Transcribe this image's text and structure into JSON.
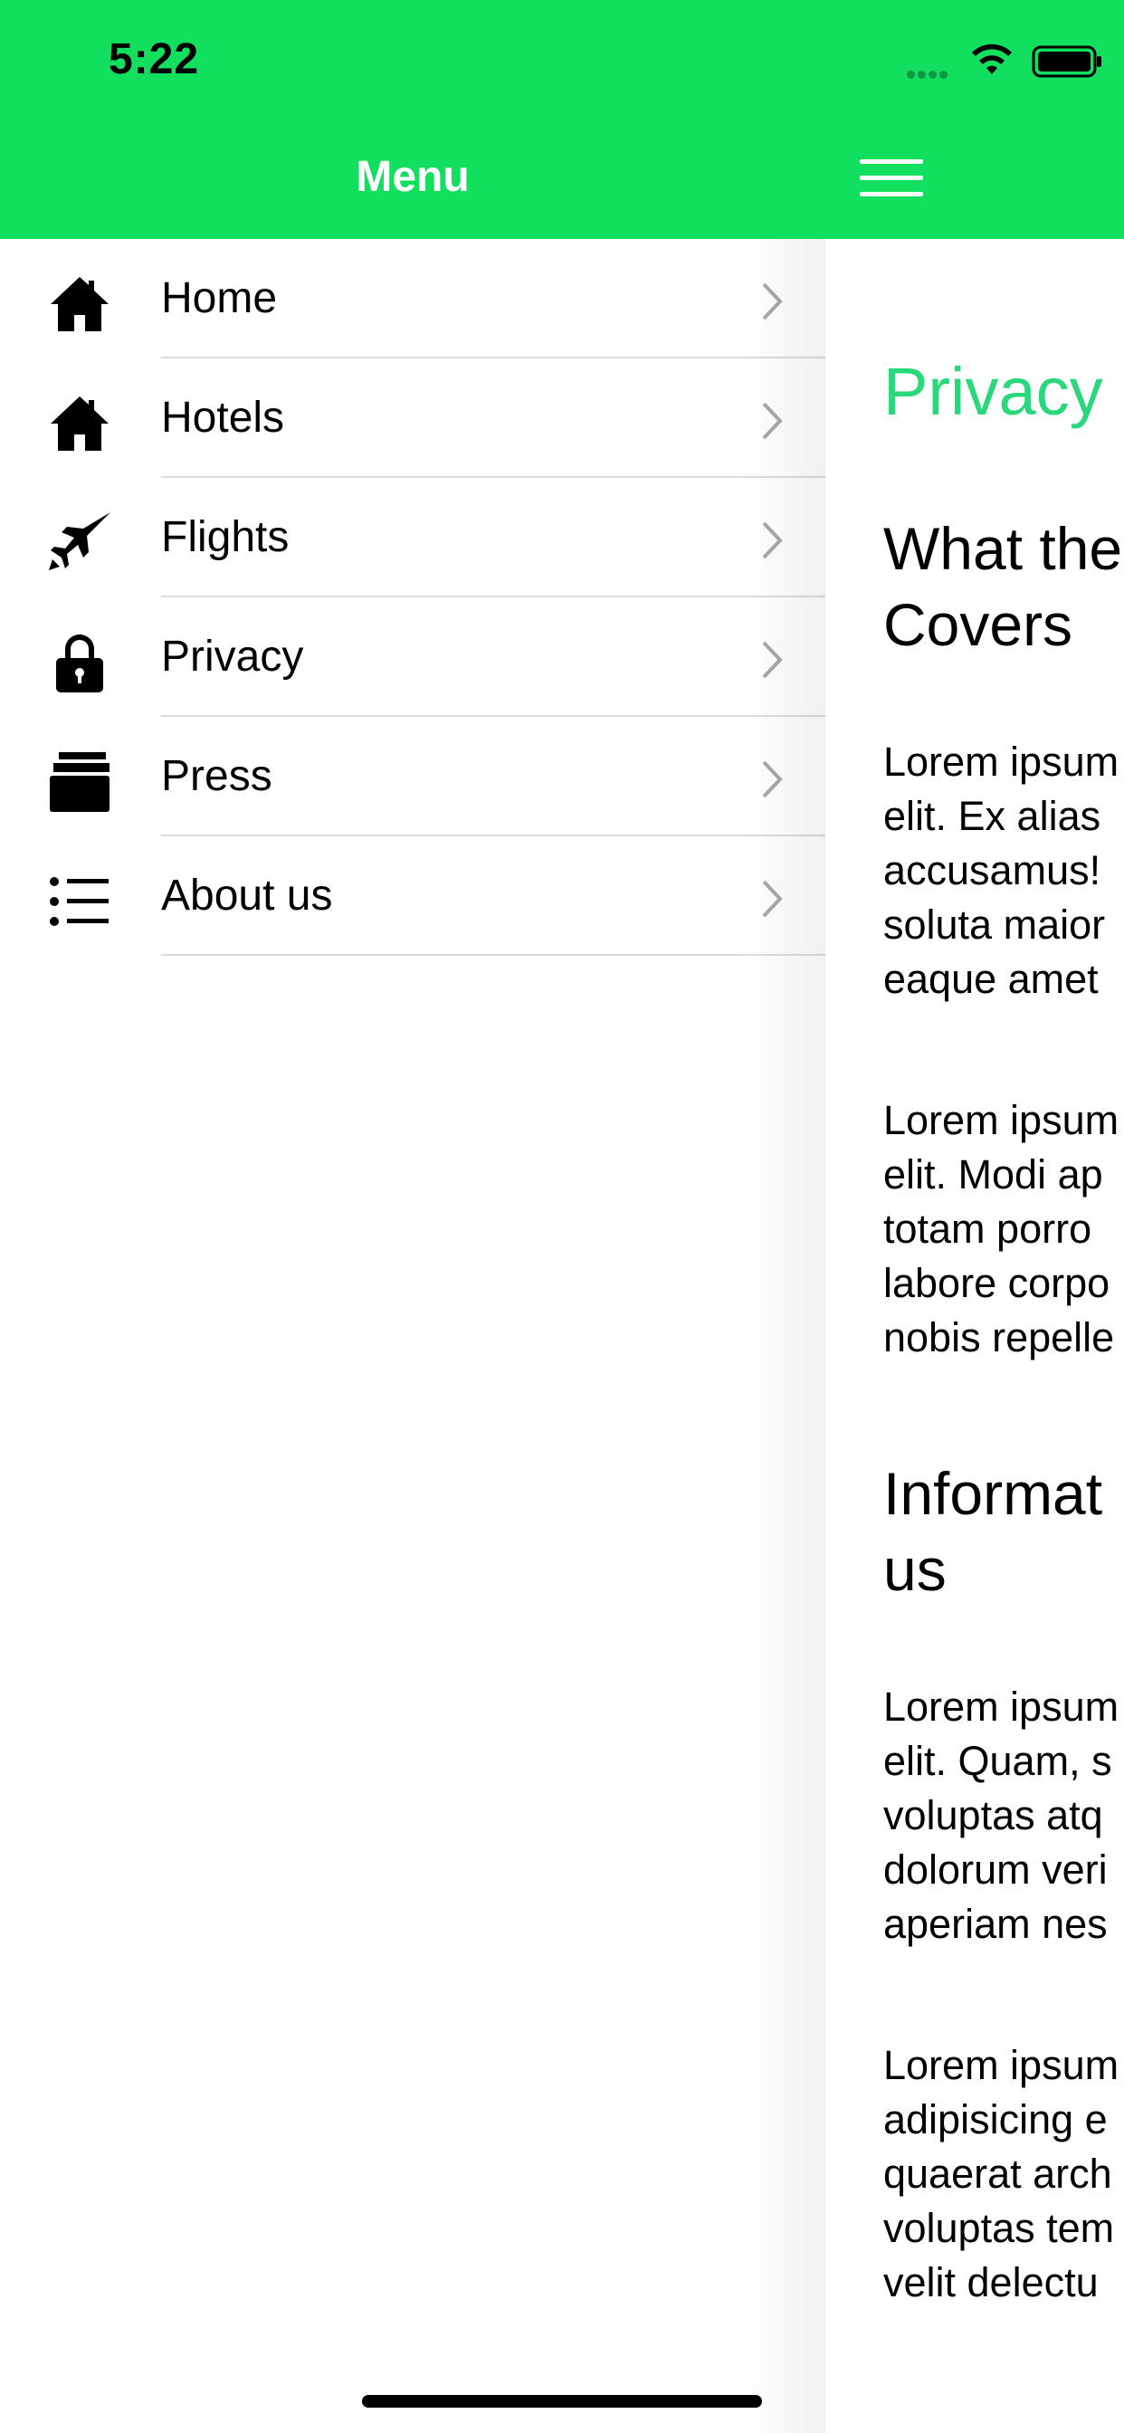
{
  "status": {
    "time": "5:22"
  },
  "header": {
    "menu_title": "Menu"
  },
  "menu": {
    "items": [
      {
        "label": "Home",
        "icon": "home-icon"
      },
      {
        "label": "Hotels",
        "icon": "home-icon"
      },
      {
        "label": "Flights",
        "icon": "jet-icon"
      },
      {
        "label": "Privacy",
        "icon": "lock-icon"
      },
      {
        "label": "Press",
        "icon": "printer-icon"
      },
      {
        "label": "About us",
        "icon": "list-icon"
      }
    ]
  },
  "content": {
    "title": "Privacy",
    "heading1": [
      "What the",
      "Covers"
    ],
    "para1": [
      "Lorem ipsum",
      "elit. Ex alias",
      "accusamus!",
      "soluta maior",
      "eaque amet"
    ],
    "para2": [
      "Lorem ipsum",
      "elit. Modi ap",
      "totam porro",
      "labore corpo",
      "nobis repelle"
    ],
    "heading2": [
      "Informat",
      "us"
    ],
    "para3": [
      "Lorem ipsum",
      "elit. Quam, s",
      "voluptas atq",
      "dolorum veri",
      "aperiam nes"
    ],
    "para4": [
      "Lorem ipsum",
      "adipisicing e",
      "quaerat arch",
      "voluptas tem",
      "velit delectu"
    ]
  },
  "colors": {
    "accent": "#13df5f",
    "title_green": "#2ad87c",
    "divider": "#dcdcdc"
  }
}
